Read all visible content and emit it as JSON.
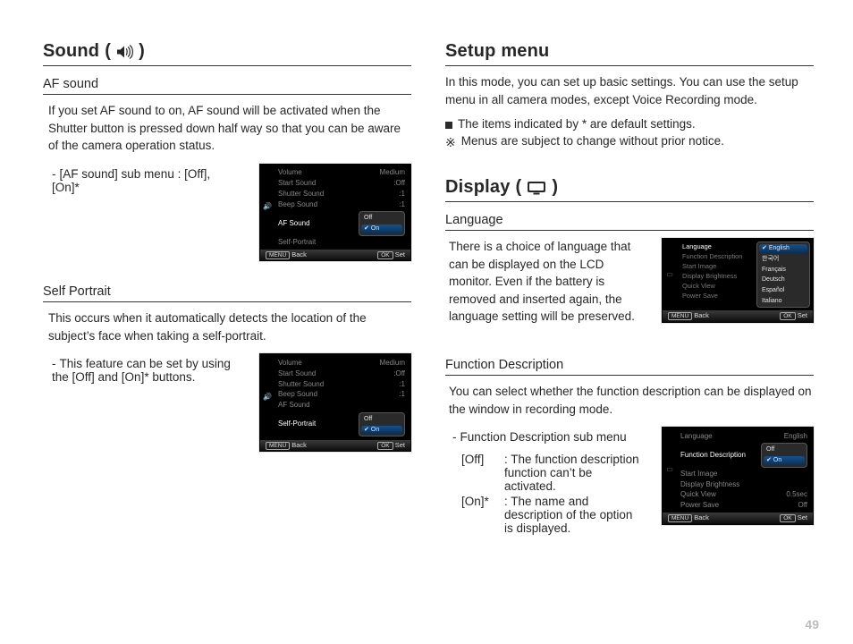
{
  "pageNumber": "49",
  "left": {
    "heading": "Sound",
    "headingSuffixOpen": "(",
    "headingSuffixClose": ")",
    "sec1": {
      "title": "AF sound",
      "para": "If you set AF sound to on, AF sound will be activated when the Shutter button is pressed down half way so that you can be aware of the camera operation status.",
      "sub": "[AF sound] sub menu : [Off], [On]*"
    },
    "sec2": {
      "title": "Self Portrait",
      "para": "This occurs when it automatically detects the location of the subject’s face when taking a self-portrait.",
      "sub": "This feature can be set by using the [Off] and [On]* buttons."
    }
  },
  "right": {
    "setupHeading": "Setup menu",
    "setupPara": "In this mode, you can set up basic settings. You can use the setup menu in all camera modes, except Voice Recording mode.",
    "note1": "The items indicated by * are default settings.",
    "note2": "Menus are subject to change without prior notice.",
    "displayHeading": "Display",
    "sec1": {
      "title": "Language",
      "para": "There is a choice of language that can be displayed on the LCD monitor. Even if the battery is removed and inserted again, the language setting will be preserved."
    },
    "sec2": {
      "title": "Function Description",
      "para": "You can select whether the function description can be displayed on the window in recording mode.",
      "pre": "Function Description sub menu",
      "offKey": "[Off]",
      "offTxt": ": The function description function can’t be activated.",
      "onKey": "[On]*",
      "onTxt": ": The name and description of the option is displayed."
    }
  },
  "lcd": {
    "bar": {
      "back": "Back",
      "set": "Set",
      "menu": "MENU",
      "ok": "OK"
    },
    "options": {
      "off": "Off",
      "on": "On"
    },
    "sound": {
      "volume": {
        "l": "Volume",
        "v": "Medium"
      },
      "start": {
        "l": "Start Sound",
        "v": ":Off"
      },
      "shutter": {
        "l": "Shutter Sound",
        "v": ":1"
      },
      "beep": {
        "l": "Beep Sound",
        "v": ":1"
      },
      "af": {
        "l": "AF Sound",
        "v": ""
      },
      "self": {
        "l": "Self-Portrait",
        "v": ""
      }
    },
    "disp": {
      "lang": {
        "l": "Language",
        "v": "English"
      },
      "fdesc": {
        "l": "Function Description",
        "v": ""
      },
      "simg": {
        "l": "Start Image",
        "v": ""
      },
      "bright": {
        "l": "Display  Brightness",
        "v": ""
      },
      "qv": {
        "l": "Quick View",
        "v": "0.5sec"
      },
      "psave": {
        "l": "Power Save",
        "v": "Off"
      }
    },
    "langOpts": [
      "English",
      "한국어",
      "Français",
      "Deutsch",
      "Español",
      "Italiano"
    ]
  }
}
